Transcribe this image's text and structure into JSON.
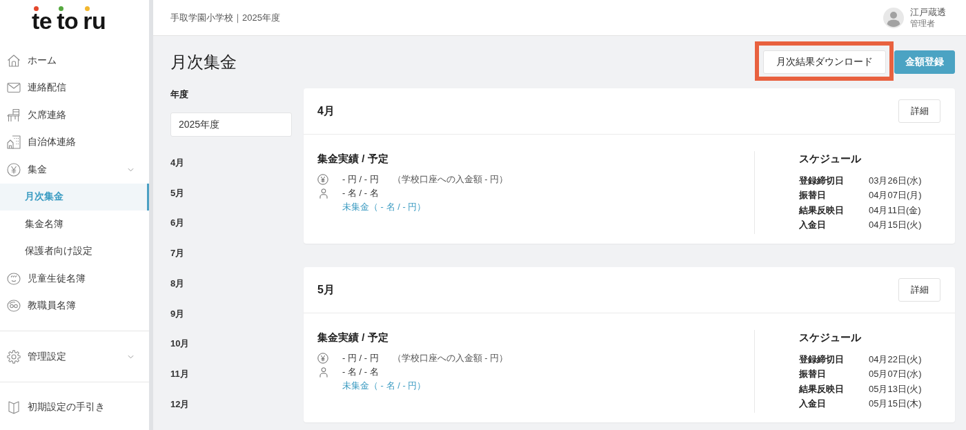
{
  "sidebar": {
    "logo": [
      {
        "text": "te",
        "color": "#e4472c"
      },
      {
        "text": "to",
        "color": "#55a83f"
      },
      {
        "text": "ru",
        "color": "#f2b72f"
      }
    ],
    "sections": [
      {
        "items": [
          {
            "kind": "link",
            "label": "ホーム",
            "selected": false
          },
          {
            "kind": "link",
            "label": "連絡配信",
            "selected": false
          },
          {
            "kind": "link",
            "label": "欠席連絡",
            "selected": false
          },
          {
            "kind": "link",
            "label": "自治体連絡",
            "selected": false
          },
          {
            "kind": "group",
            "label": "集金",
            "selected": false,
            "children": [
              {
                "label": "月次集金",
                "selected": true
              },
              {
                "label": "集金名簿",
                "selected": false
              },
              {
                "label": "保護者向け設定",
                "selected": false
              }
            ]
          },
          {
            "kind": "link",
            "label": "児童生徒名簿",
            "selected": false
          },
          {
            "kind": "link",
            "label": "教職員名簿",
            "selected": false
          }
        ]
      },
      {
        "items": [
          {
            "kind": "group",
            "label": "管理設定",
            "selected": false
          }
        ]
      },
      {
        "items": [
          {
            "kind": "link",
            "label": "初期設定の手引き",
            "selected": false
          }
        ]
      }
    ]
  },
  "header": {
    "school": "手取学園小学校｜2025年度",
    "user": {
      "name": "江戸蔵透",
      "role": "管理者"
    }
  },
  "page": {
    "title": "月次集金",
    "buttons": [
      {
        "kind": "secondary",
        "label": "月次結果ダウンロード",
        "highlighted": true
      },
      {
        "kind": "primary",
        "label": "金額登録",
        "highlighted": false
      }
    ]
  },
  "filter": {
    "label": "年度",
    "value": "2025年度",
    "months": [
      "4月",
      "5月",
      "6月",
      "7月",
      "8月",
      "9月",
      "10月",
      "11月",
      "12月"
    ]
  },
  "cards": [
    {
      "title": "4月",
      "detail_button": "詳細",
      "summary": {
        "title": "集金実績 / 予定",
        "amount": "- 円 / - 円",
        "deposit": "（学校口座への入金額 - 円）",
        "people": "- 名 / - 名",
        "uncollected": "未集金（ - 名 / - 円）"
      },
      "schedule": {
        "title": "スケジュール",
        "rows": [
          {
            "label": "登録締切日",
            "value": "03月26日(水)"
          },
          {
            "label": "振替日",
            "value": "04月07日(月)"
          },
          {
            "label": "結果反映日",
            "value": "04月11日(金)"
          },
          {
            "label": "入金日",
            "value": "04月15日(火)"
          }
        ]
      }
    },
    {
      "title": "5月",
      "detail_button": "詳細",
      "summary": {
        "title": "集金実績 / 予定",
        "amount": "- 円 / - 円",
        "deposit": "（学校口座への入金額 - 円）",
        "people": "- 名 / - 名",
        "uncollected": "未集金（ - 名 / - 円）"
      },
      "schedule": {
        "title": "スケジュール",
        "rows": [
          {
            "label": "登録締切日",
            "value": "04月22日(火)"
          },
          {
            "label": "振替日",
            "value": "05月07日(水)"
          },
          {
            "label": "結果反映日",
            "value": "05月13日(火)"
          },
          {
            "label": "入金日",
            "value": "05月15日(木)"
          }
        ]
      }
    }
  ]
}
